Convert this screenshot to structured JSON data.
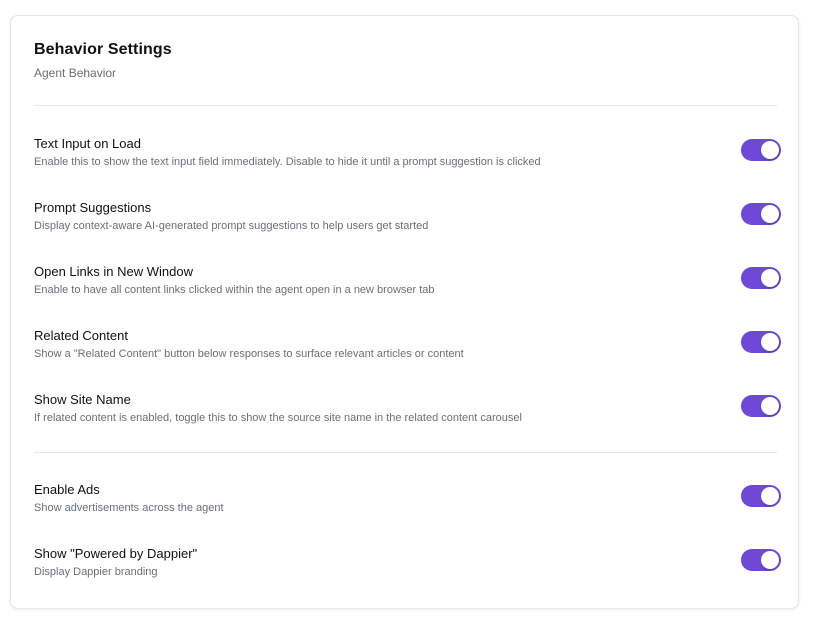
{
  "header": {
    "title": "Behavior Settings",
    "subtitle": "Agent Behavior"
  },
  "colors": {
    "toggle_on": "#6f48d8",
    "text_primary": "#111111",
    "text_secondary": "#6b6f76"
  },
  "settings": [
    {
      "label": "Text Input on Load",
      "description": "Enable this to show the text input field immediately. Disable to hide it until a prompt suggestion is clicked",
      "enabled": true
    },
    {
      "label": "Prompt Suggestions",
      "description": "Display context-aware AI-generated prompt suggestions to help users get started",
      "enabled": true
    },
    {
      "label": "Open Links in New Window",
      "description": "Enable to have all content links clicked within the agent open in a new browser tab",
      "enabled": true
    },
    {
      "label": "Related Content",
      "description": "Show a \"Related Content\" button below responses to surface relevant articles or content",
      "enabled": true
    },
    {
      "label": "Show Site Name",
      "description": "If related content is enabled, toggle this to show the source site name in the related content carousel",
      "enabled": true
    },
    {
      "label": "Enable Ads",
      "description": "Show advertisements across the agent",
      "enabled": true
    },
    {
      "label": "Show \"Powered by Dappier\"",
      "description": "Display Dappier branding",
      "enabled": true
    }
  ]
}
